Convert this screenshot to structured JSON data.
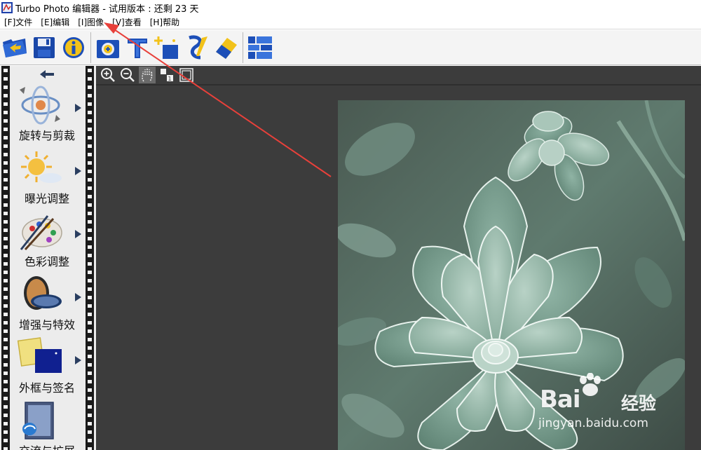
{
  "window": {
    "title": "Turbo Photo 编辑器 - 试用版本 : 还剩 23 天",
    "app_icon": "turbo-photo-app-icon"
  },
  "menu": [
    {
      "label": "[F]文件",
      "name": "menu-file"
    },
    {
      "label": "[E]编辑",
      "name": "menu-edit"
    },
    {
      "label": "[I]图像",
      "name": "menu-image"
    },
    {
      "label": "[V]查看",
      "name": "menu-view"
    },
    {
      "label": "[H]帮助",
      "name": "menu-help"
    }
  ],
  "toolbar": {
    "buttons": [
      {
        "icon": "open-folder-icon"
      },
      {
        "icon": "save-disk-icon"
      },
      {
        "icon": "info-icon"
      },
      {
        "icon": "add-photo-icon"
      },
      {
        "icon": "text-icon"
      },
      {
        "icon": "sparkle-add-icon"
      },
      {
        "icon": "brush-icon"
      },
      {
        "icon": "eraser-icon"
      },
      {
        "icon": "grid-layout-icon"
      }
    ]
  },
  "sidebar": {
    "back_icon": "back-arrow-icon",
    "items": [
      {
        "label": "旋转与剪裁",
        "icon": "rotate-crop-icon"
      },
      {
        "label": "曝光调整",
        "icon": "exposure-sun-icon"
      },
      {
        "label": "色彩调整",
        "icon": "palette-icon"
      },
      {
        "label": "增强与特效",
        "icon": "lens-filter-icon"
      },
      {
        "label": "外框与签名",
        "icon": "frame-signature-icon"
      },
      {
        "label": "交流与扩展",
        "icon": "share-extend-icon"
      }
    ]
  },
  "view_toolbar": {
    "buttons": [
      {
        "icon": "zoom-in-icon"
      },
      {
        "icon": "zoom-out-icon"
      },
      {
        "icon": "hand-pan-icon"
      },
      {
        "icon": "actual-size-icon"
      },
      {
        "icon": "fit-window-icon"
      }
    ]
  },
  "canvas": {
    "image": "succulent-plant-photo"
  },
  "watermark": {
    "brand": "Bai",
    "brand_cn": "经验",
    "url": "jingyan.baidu.com"
  },
  "colors": {
    "workspace_bg": "#3c3c3c",
    "annotation_arrow": "#e8403a",
    "plant_green": "#8fb3a4"
  }
}
